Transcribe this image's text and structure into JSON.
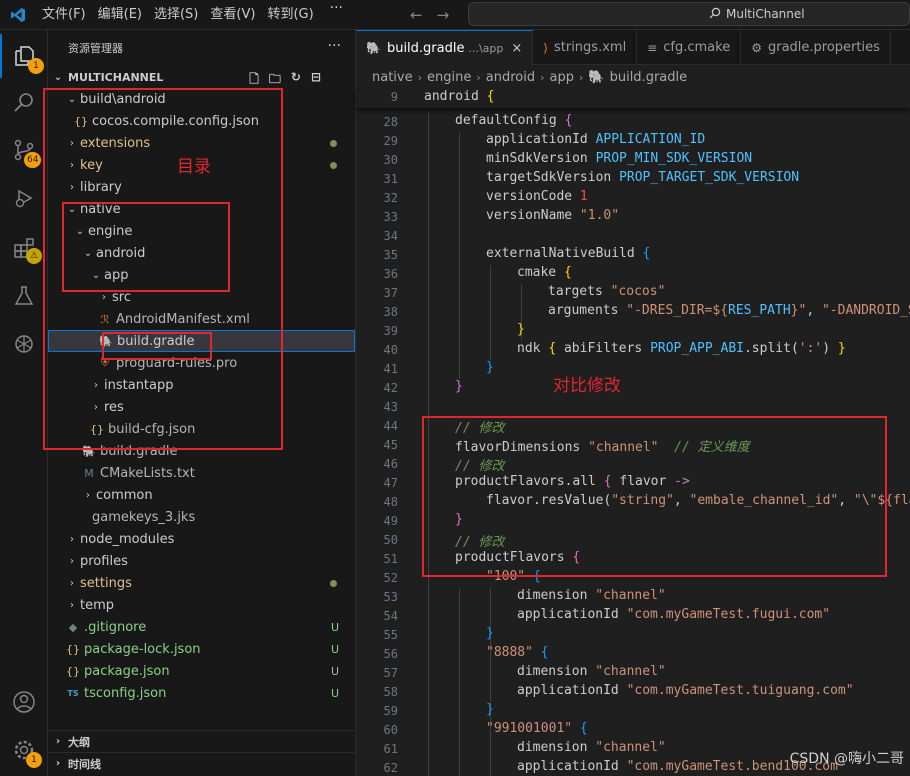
{
  "titlebar": {
    "menu": [
      "文件(F)",
      "编辑(E)",
      "选择(S)",
      "查看(V)",
      "转到(G)"
    ],
    "more": "···",
    "search_text": "MultiChannel"
  },
  "activity": {
    "explorer_badge": "1",
    "scm_badge": "64",
    "accounts_badge": "",
    "settings_badge": "1"
  },
  "sidebar": {
    "title": "资源管理器",
    "more": "···",
    "root": "MULTICHANNEL",
    "tree": [
      {
        "label": "build\\android",
        "tw": "⌄",
        "status": ""
      },
      {
        "label": "cocos.compile.config.json",
        "icon": "{}",
        "status": ""
      },
      {
        "label": "extensions",
        "tw": "›",
        "status": "dot"
      },
      {
        "label": "key",
        "tw": "›",
        "status": "dot"
      },
      {
        "label": "library",
        "tw": "›",
        "status": ""
      },
      {
        "label": "native",
        "tw": "⌄",
        "status": ""
      },
      {
        "label": "engine",
        "tw": "⌄",
        "status": ""
      },
      {
        "label": "android",
        "tw": "⌄",
        "status": ""
      },
      {
        "label": "app",
        "tw": "⌄",
        "status": ""
      },
      {
        "label": "src",
        "tw": "›",
        "status": ""
      },
      {
        "label": "AndroidManifest.xml",
        "icon": "xml",
        "status": ""
      },
      {
        "label": "build.gradle",
        "icon": "gradle",
        "status": ""
      },
      {
        "label": "proguard-rules.pro",
        "icon": "pro",
        "status": ""
      },
      {
        "label": "instantapp",
        "tw": "›",
        "status": ""
      },
      {
        "label": "res",
        "tw": "›",
        "status": ""
      },
      {
        "label": "build-cfg.json",
        "icon": "{}",
        "status": ""
      },
      {
        "label": "build.gradle",
        "icon": "gradle",
        "status": ""
      },
      {
        "label": "CMakeLists.txt",
        "icon": "M",
        "status": ""
      },
      {
        "label": "common",
        "tw": "›",
        "status": ""
      },
      {
        "label": "gamekeys_3.jks",
        "icon": "",
        "status": ""
      },
      {
        "label": "node_modules",
        "tw": "›",
        "status": ""
      },
      {
        "label": "profiles",
        "tw": "›",
        "status": ""
      },
      {
        "label": "settings",
        "tw": "›",
        "status": "dot"
      },
      {
        "label": "temp",
        "tw": "›",
        "status": ""
      },
      {
        "label": ".gitignore",
        "icon": "git",
        "status": "U"
      },
      {
        "label": "package-lock.json",
        "icon": "{}",
        "status": "U"
      },
      {
        "label": "package.json",
        "icon": "{}",
        "status": "U"
      },
      {
        "label": "tsconfig.json",
        "icon": "TS",
        "status": "U"
      }
    ],
    "outline": "大纲",
    "timeline": "时间线"
  },
  "annotations": {
    "dir_label": "目录",
    "diff_label": "对比修改"
  },
  "tabs": [
    {
      "label": "build.gradle",
      "desc": "...\\app",
      "close": "×"
    },
    {
      "label": "strings.xml",
      "desc": ""
    },
    {
      "label": "cfg.cmake",
      "desc": ""
    },
    {
      "label": "gradle.properties",
      "desc": ""
    }
  ],
  "breadcrumbs": [
    "native",
    "engine",
    "android",
    "app",
    "build.gradle"
  ],
  "watermark": "CSDN @嗨小二哥",
  "colors": {
    "accent": "#0078d4",
    "annotation": "#e0262f"
  }
}
